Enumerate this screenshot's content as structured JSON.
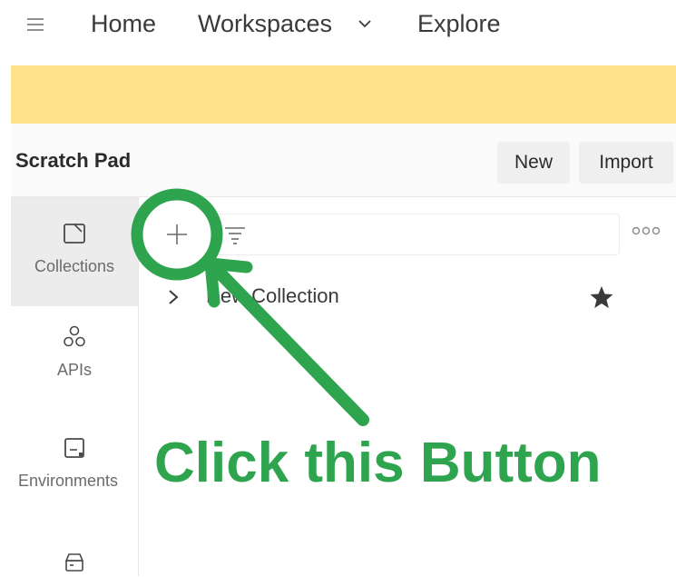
{
  "nav": {
    "home": "Home",
    "workspaces": "Workspaces",
    "explore": "Explore"
  },
  "workspace": {
    "title": "Scratch Pad",
    "new_label": "New",
    "import_label": "Import"
  },
  "sidebar": {
    "items": [
      {
        "label": "Collections",
        "icon": "collections-icon",
        "active": true
      },
      {
        "label": "APIs",
        "icon": "apis-icon"
      },
      {
        "label": "Environments",
        "icon": "environments-icon"
      },
      {
        "label": "",
        "icon": "mock-servers-icon"
      }
    ]
  },
  "collections": {
    "items": [
      {
        "name": "New Collection",
        "starred": true
      }
    ]
  },
  "annotation": {
    "text": "Click this Button",
    "color": "#2ea44f"
  },
  "colors": {
    "banner": "#ffe28a",
    "active_sidebar": "#ececec"
  }
}
